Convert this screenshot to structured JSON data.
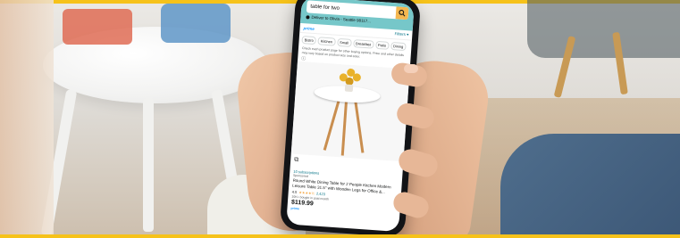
{
  "search": {
    "query": "table for two"
  },
  "location": {
    "text": "Deliver to Olivia - Seattle 98117..."
  },
  "toolbar": {
    "prime_label": "prime",
    "filters_label": "Filters"
  },
  "chips": [
    "Bistro",
    "Kitchen",
    "Small",
    "Breakfast",
    "Patio",
    "Dining"
  ],
  "notice": "Check each product page for other buying options. Price and other details may vary based on product size and color.",
  "product": {
    "subscriptions": "10 subscriptions",
    "sponsored": "Sponsored",
    "title": "Round White Dining Table for 2 People Kitchen Modern Leisure Table 31.5\" with Wooden Legs for Office &...",
    "rating": "4.5",
    "stars": "★★★★½",
    "review_count": "2,423",
    "bought": "10K+ bought in past month",
    "price": "$119.99",
    "badge": "prime"
  },
  "colors": {
    "header": "#76c7c9",
    "search_button": "#f5b750",
    "prime_blue": "#1a98ff",
    "banner": "#f6c21a"
  },
  "icons": {
    "search": "magnifier-icon",
    "location": "location-pin-icon",
    "filters": "chevron-down-icon",
    "info": "info-icon",
    "compare": "compare-icon"
  }
}
